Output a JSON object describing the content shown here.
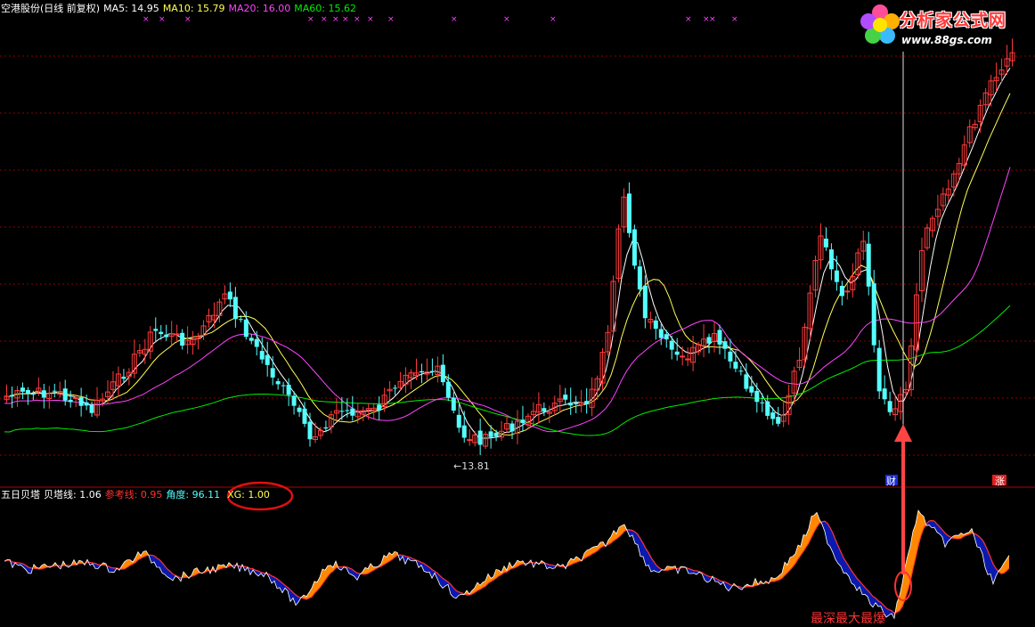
{
  "top_header": {
    "title": "空港股份(日线 前复权)",
    "ma5": "MA5: 14.95",
    "ma10": "MA10: 15.79",
    "ma20": "MA20: 16.00",
    "ma60": "MA60: 15.62"
  },
  "indicator_header": {
    "name": "五日贝塔",
    "beta": "贝塔线: 1.06",
    "ref": "参考线: 0.95",
    "angle": "角度: 96.11",
    "xg": "XG: 1.00"
  },
  "logo": {
    "title": "分析家公式网",
    "url": "www.88gs.com"
  },
  "annotations": {
    "low_price": "←13.81",
    "cai_marker": "财",
    "zhang_marker": "涨",
    "caption": "最深最大最爆"
  },
  "colors": {
    "bg": "#000000",
    "up": "#ff3b3b",
    "down": "#54ffff",
    "ma5": "#ffffff",
    "ma10": "#ffff55",
    "ma20": "#ff44ff",
    "ma60": "#00ee00",
    "grid": "#8b0000",
    "orange": "#ff8800",
    "blue": "#0a1ab0",
    "annotation": "#ff3333"
  }
}
